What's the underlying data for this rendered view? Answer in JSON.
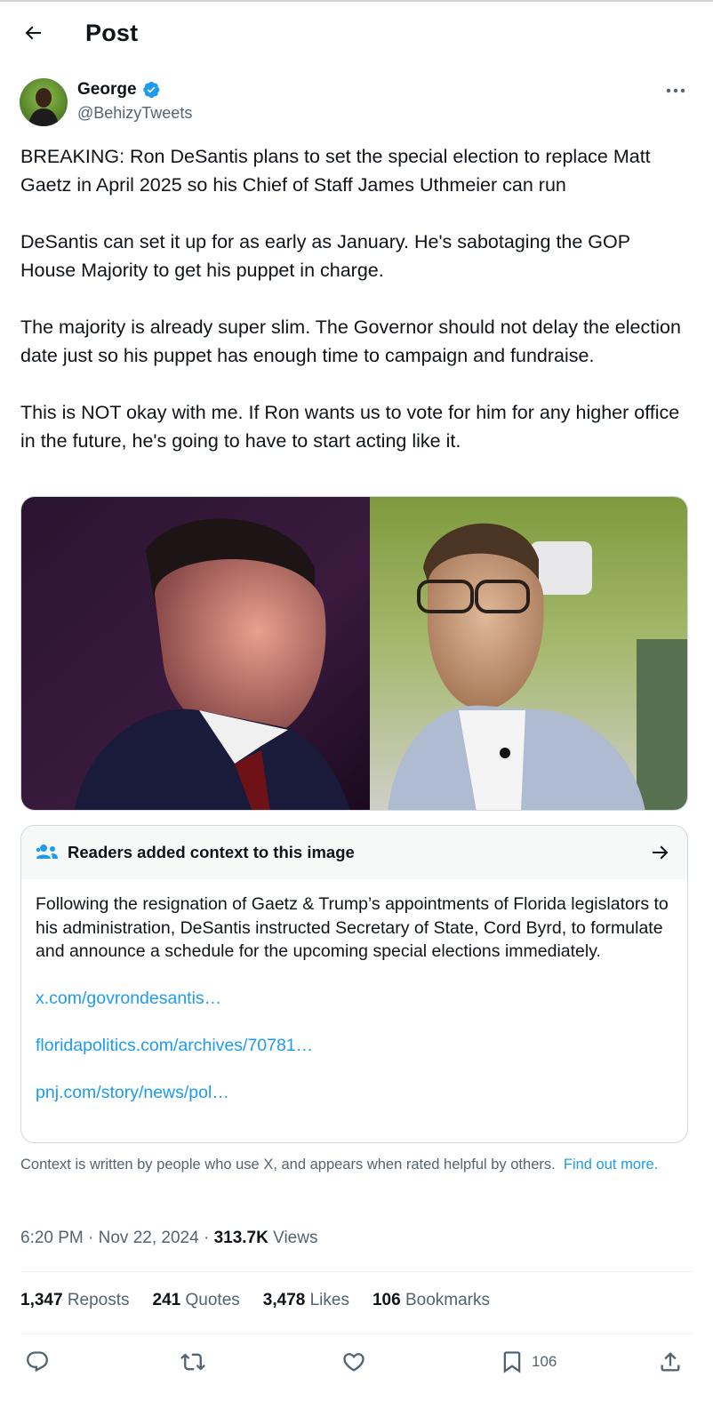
{
  "header": {
    "title": "Post"
  },
  "author": {
    "name": "George",
    "handle": "@BehizyTweets",
    "verified": true
  },
  "post": {
    "paragraphs": [
      "BREAKING: Ron DeSantis plans to set the special election to replace Matt Gaetz in April 2025 so his Chief of Staff James Uthmeier can run",
      "DeSantis can set it up for as early as January. He's sabotaging the GOP House Majority to get his puppet in charge.",
      "The majority is already super slim. The Governor should not delay the election date just so his puppet has enough time to campaign and fundraise.",
      "This is NOT okay with me. If Ron wants us to vote for him for any higher office in the future, he's going to have to start acting like it."
    ]
  },
  "community_note": {
    "title": "Readers added context to this image",
    "body": "Following the resignation of Gaetz & Trump’s appointments of Florida legislators to his administration, DeSantis instructed Secretary of State, Cord Byrd, to formulate and announce a schedule for the upcoming special elections immediately.",
    "links": [
      "x.com/govrondesantis…",
      "floridapolitics.com/archives/70781…",
      "pnj.com/story/news/pol…"
    ]
  },
  "disclaimer": {
    "text": "Context is written by people who use X, and appears when rated helpful by others.",
    "link": "Find out more."
  },
  "meta": {
    "time": "6:20 PM · Nov 22, 2024 · ",
    "views_count": "313.7K",
    "views_label": " Views"
  },
  "stats": {
    "reposts_count": "1,347",
    "reposts_label": "Reposts",
    "quotes_count": "241",
    "quotes_label": "Quotes",
    "likes_count": "3,478",
    "likes_label": "Likes",
    "bookmarks_count": "106",
    "bookmarks_label": "Bookmarks"
  },
  "actions": {
    "bookmark_count": "106"
  },
  "colors": {
    "accent": "#1d9bf0",
    "text": "#0f1419",
    "muted": "#536471",
    "border": "#cfd9de"
  },
  "icons": [
    "back-arrow-icon",
    "verified-badge-icon",
    "more-options-icon",
    "community-note-icon",
    "arrow-right-icon",
    "reply-icon",
    "repost-icon",
    "like-icon",
    "bookmark-icon",
    "share-icon"
  ]
}
